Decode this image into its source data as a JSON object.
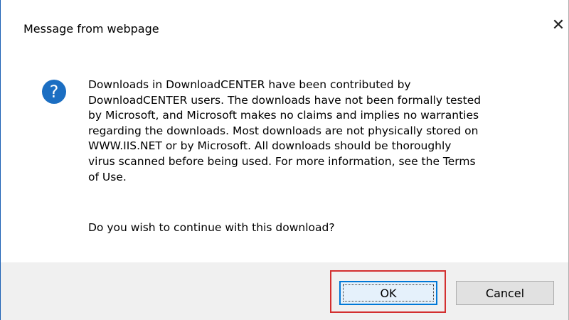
{
  "dialog": {
    "title": "Message from webpage",
    "close_glyph": "✕",
    "icon": "question-icon",
    "message": "Downloads in DownloadCENTER have been contributed by\nDownloadCENTER users.  The downloads have not been formally tested\nby Microsoft, and Microsoft makes no claims and implies no warranties\nregarding the downloads.  Most downloads are not physically stored on\nWWW.IIS.NET or by Microsoft.  All downloads should be thoroughly\nvirus scanned before being used. For more information, see the Terms\nof Use.",
    "prompt": "Do you wish to continue with this download?",
    "buttons": {
      "ok_label": "OK",
      "cancel_label": "Cancel"
    },
    "colors": {
      "icon_blue": "#1b6ec2",
      "focus_blue": "#0078d7",
      "highlight_red": "#d32f2f"
    }
  }
}
